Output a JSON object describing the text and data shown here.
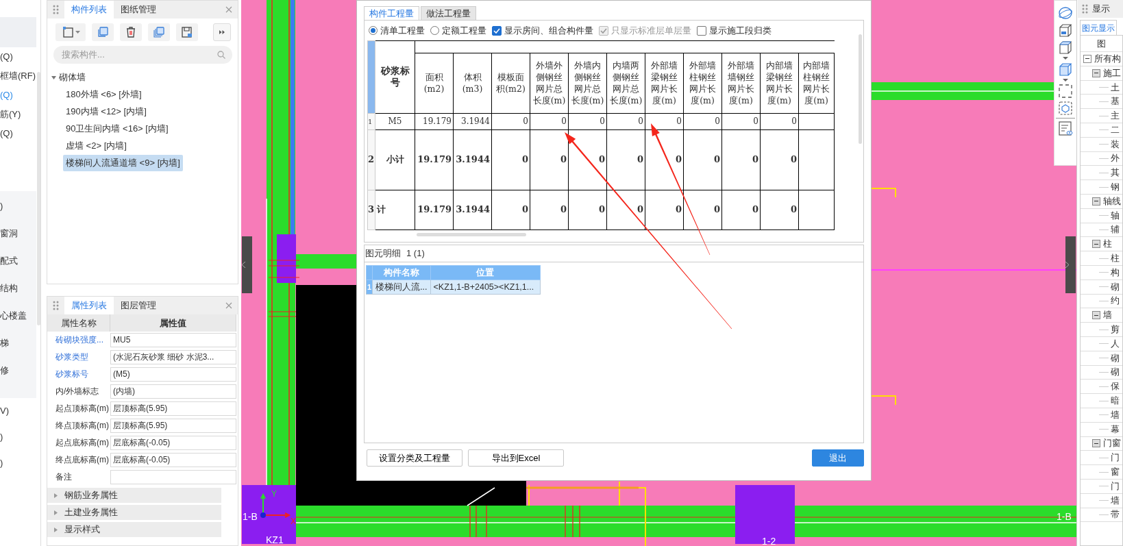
{
  "left_nav": {
    "top_items": [
      {
        "label": "(Q)",
        "highlighted": false
      },
      {
        "label": "框墙(RF)",
        "highlighted": false
      },
      {
        "label": "(Q)",
        "highlighted": true
      },
      {
        "label": "筋(Y)",
        "highlighted": false
      },
      {
        "label": "(Q)",
        "highlighted": false
      }
    ],
    "mid_items": [
      ")",
      "窗洞",
      "配式",
      "结构",
      "心楼盖",
      "梯",
      "修"
    ],
    "bottom_items": [
      "V)",
      ")",
      ")"
    ]
  },
  "component_panel": {
    "tabs": [
      {
        "label": "构件列表",
        "selected": true
      },
      {
        "label": "图纸管理",
        "selected": false
      }
    ],
    "search": {
      "placeholder": "搜索构件..."
    },
    "tree": [
      {
        "label": "砌体墙",
        "expanded": true,
        "children": [
          {
            "label": "180外墙 <6> [外墙]",
            "selected": false
          },
          {
            "label": "190内墙 <12> [内墙]",
            "selected": false
          },
          {
            "label": "90卫生间内墙 <16> [内墙]",
            "selected": false
          },
          {
            "label": "虚墙 <2> [内墙]",
            "selected": false
          },
          {
            "label": "楼梯间人流通道墙 <9> [内墙]",
            "selected": true
          }
        ]
      }
    ]
  },
  "property_panel": {
    "tabs": [
      {
        "label": "属性列表",
        "selected": true
      },
      {
        "label": "图层管理",
        "selected": false
      }
    ],
    "columns": [
      "属性名称",
      "属性值"
    ],
    "rows": [
      {
        "name": "砖砌块强度...",
        "value": "MU5",
        "kind": "link"
      },
      {
        "name": "砂浆类型",
        "value": "(水泥石灰砂浆 细砂  水泥3...",
        "kind": "link"
      },
      {
        "name": "砂浆标号",
        "value": "(M5)",
        "kind": "link"
      },
      {
        "name": "内/外墙标志",
        "value": "(内墙)",
        "kind": "plain"
      },
      {
        "name": "起点顶标高(m)",
        "value": "层顶标高(5.95)",
        "kind": "plain"
      },
      {
        "name": "终点顶标高(m)",
        "value": "层顶标高(5.95)",
        "kind": "plain"
      },
      {
        "name": "起点底标高(m)",
        "value": "层底标高(-0.05)",
        "kind": "plain"
      },
      {
        "name": "终点底标高(m)",
        "value": "层底标高(-0.05)",
        "kind": "plain"
      },
      {
        "name": "备注",
        "kind": "plain"
      }
    ],
    "groups": [
      {
        "label": "钢筋业务属性",
        "expanded": false
      },
      {
        "label": "土建业务属性",
        "expanded": false
      },
      {
        "label": "显示样式",
        "expanded": false
      }
    ]
  },
  "canvas_labels": [
    "1-B",
    "1-B",
    "KZ1",
    "1-2",
    "Y",
    "X"
  ],
  "dialog": {
    "tabs": [
      {
        "label": "构件工程量",
        "selected": true
      },
      {
        "label": "做法工程量",
        "selected": false
      }
    ],
    "options": [
      {
        "kind": "radio",
        "label": "清单工程量",
        "checked": true,
        "disabled": false
      },
      {
        "kind": "radio",
        "label": "定额工程量",
        "checked": false,
        "disabled": false
      },
      {
        "kind": "checkbox",
        "label": "显示房间、组合构件量",
        "checked": true,
        "disabled": false
      },
      {
        "kind": "checkbox",
        "label": "只显示标准层单层量",
        "checked": true,
        "disabled": true
      },
      {
        "kind": "checkbox",
        "label": "显示施工段归类",
        "checked": false,
        "disabled": false
      }
    ],
    "table": {
      "columns": [
        "砂浆标号",
        "面积(m2)",
        "体积(m3)",
        "模板面积(m2)",
        "外墙外侧钢丝网片总长度(m)",
        "外墙内侧钢丝网片总长度(m)",
        "内墙两侧钢丝网片总长度(m)",
        "外部墙梁钢丝网片长度(m)",
        "外部墙柱钢丝网片长度(m)",
        "外部墙墙钢丝网片长度(m)",
        "内部墙梁钢丝网片长度(m)",
        "内部墙柱钢丝网片长度(m)"
      ],
      "rows": [
        {
          "number": "1",
          "kind": "data",
          "label": "M5",
          "values": [
            "19.179",
            "3.1944",
            "0",
            "0",
            "0",
            "0",
            "0",
            "0",
            "0",
            "0"
          ]
        },
        {
          "number": "2",
          "kind": "subtotal",
          "label": "小计",
          "values": [
            "19.179",
            "3.1944",
            "0",
            "0",
            "0",
            "0",
            "0",
            "0",
            "0",
            "0"
          ]
        },
        {
          "number": "3",
          "kind": "total",
          "label": "计",
          "values": [
            "19.179",
            "3.1944",
            "0",
            "0",
            "0",
            "0",
            "0",
            "0",
            "0",
            "0"
          ]
        }
      ]
    },
    "detail": {
      "title": "图元明细",
      "count": "1 (1)",
      "columns": [
        "构件名称",
        "位置"
      ],
      "rows": [
        {
          "number": "1",
          "cells": [
            "楼梯间人流...",
            "<KZ1,1-B+2405><KZ1,1..."
          ]
        }
      ]
    },
    "buttons": [
      {
        "label": "设置分类及工程量",
        "kind": "secondary"
      },
      {
        "label": "导出到Excel",
        "kind": "secondary"
      },
      {
        "label": "退出",
        "kind": "primary"
      }
    ]
  },
  "display_panel": {
    "title": "显示",
    "tabs": [
      {
        "label": "图元显示",
        "selected": true
      }
    ],
    "column": "图",
    "tree": [
      {
        "label": "所有构",
        "expanded": true,
        "children": [
          {
            "label": "施工",
            "expanded": true,
            "children": [
              {
                "label": "土"
              },
              {
                "label": "基"
              },
              {
                "label": "主"
              },
              {
                "label": "二"
              },
              {
                "label": "装"
              },
              {
                "label": "外"
              },
              {
                "label": "其"
              },
              {
                "label": "钢"
              }
            ]
          },
          {
            "label": "轴线",
            "expanded": true,
            "children": [
              {
                "label": "轴"
              },
              {
                "label": "辅"
              }
            ]
          },
          {
            "label": "柱",
            "expanded": true,
            "children": [
              {
                "label": "柱"
              },
              {
                "label": "构"
              },
              {
                "label": "砌"
              },
              {
                "label": "约"
              }
            ]
          },
          {
            "label": "墙",
            "expanded": true,
            "children": [
              {
                "label": "剪"
              },
              {
                "label": "人"
              },
              {
                "label": "砌"
              },
              {
                "label": "砌"
              },
              {
                "label": "保"
              },
              {
                "label": "暗"
              },
              {
                "label": "墙"
              },
              {
                "label": "幕"
              }
            ]
          },
          {
            "label": "门窗",
            "expanded": true,
            "children": [
              {
                "label": "门"
              },
              {
                "label": "窗"
              },
              {
                "label": "门"
              },
              {
                "label": "墙"
              },
              {
                "label": "带"
              }
            ]
          }
        ]
      }
    ]
  }
}
